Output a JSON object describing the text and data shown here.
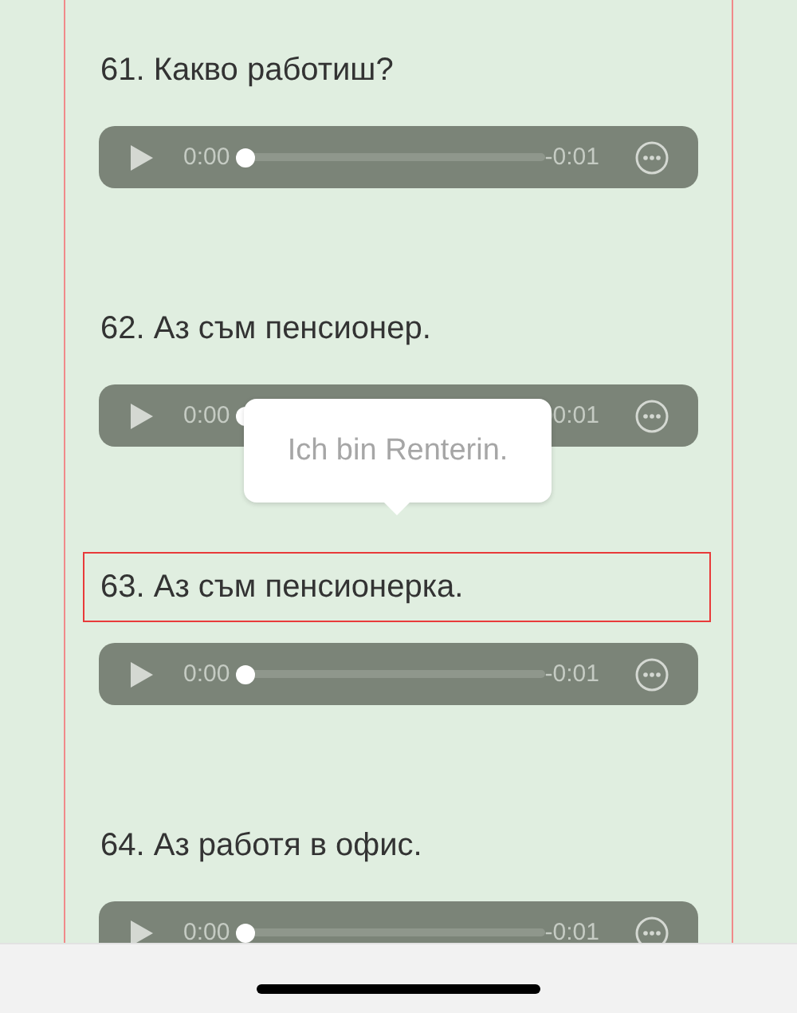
{
  "items": [
    {
      "title": "61. Какво работиш?",
      "selected": false,
      "player": {
        "current": "0:00",
        "remaining": "-0:01",
        "level": 0
      }
    },
    {
      "title": "62. Аз съм пенсионер.",
      "selected": false,
      "player": {
        "current": "0:00",
        "remaining": "0:01",
        "level": 0
      }
    },
    {
      "title": "63. Аз съм пенсионерка.",
      "selected": true,
      "player": {
        "current": "0:00",
        "remaining": "-0:01",
        "level": 0
      }
    },
    {
      "title": "64. Аз работя в офис.",
      "selected": false,
      "player": {
        "current": "0:00",
        "remaining": "-0:01",
        "level": 0
      }
    }
  ],
  "tooltip": {
    "text": "Ich bin Renterin."
  }
}
